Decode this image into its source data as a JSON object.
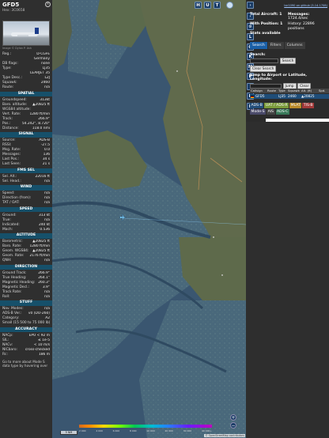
{
  "aircraft": {
    "callsign": "GFD5",
    "hex_line": "Hex: 3C0658",
    "photo_credit": "Image © Dylan P. Ash",
    "close_icon": "close-icon"
  },
  "info_top": [
    {
      "k": "Reg.:",
      "v": "D-CGFE"
    },
    {
      "k": "",
      "v": "Germany"
    },
    {
      "k": "DB flags:",
      "v": "none"
    },
    {
      "k": "Type:",
      "v": "LJ35"
    },
    {
      "k": "",
      "v": "LEARJET 35"
    },
    {
      "k": "Type Desc.:",
      "v": "L2J"
    },
    {
      "k": "Squawk:",
      "v": "2460"
    },
    {
      "k": "Route:",
      "v": "n/a"
    }
  ],
  "sections": [
    {
      "title": "SPATIAL",
      "rows": [
        {
          "k": "Groundspeed:",
          "v": "313kt"
        },
        {
          "k": "Baro. altitude:",
          "v": "▲20825 ft"
        },
        {
          "k": "WGS84 altitude:",
          "v": ""
        },
        {
          "k": "Vert. Rate:",
          "v": "1280 ft/min"
        },
        {
          "k": "Track:",
          "v": "266.9°"
        },
        {
          "k": "Pos.:",
          "v": "54.242°, 8.720°"
        },
        {
          "k": "Distance:",
          "v": "118.0 nmi"
        }
      ]
    },
    {
      "title": "SIGNAL",
      "rows": [
        {
          "k": "Source:",
          "v": "ADS-B"
        },
        {
          "k": "RSSI:",
          "v": "-27.5"
        },
        {
          "k": "Msg. Rate:",
          "v": "0.0"
        },
        {
          "k": "Messages:",
          "v": "136"
        },
        {
          "k": "Last Pos.:",
          "v": "34 s"
        },
        {
          "k": "Last Seen:",
          "v": "21 s"
        }
      ]
    },
    {
      "title": "FMS SEL",
      "rows": [
        {
          "k": "Sel. Alt.:",
          "v": "22016 ft"
        },
        {
          "k": "Sel. Head.:",
          "v": "n/a"
        }
      ]
    },
    {
      "title": "WIND",
      "rows": [
        {
          "k": "Speed:",
          "v": "n/a"
        },
        {
          "k": "Direction (from):",
          "v": "n/a"
        },
        {
          "k": "TAT / OAT:",
          "v": "n/a"
        }
      ]
    },
    {
      "title": "SPEED",
      "rows": [
        {
          "k": "Ground:",
          "v": "313 kt"
        },
        {
          "k": "True:",
          "v": "n/a"
        },
        {
          "k": "Indicated:",
          "v": "240 kt"
        },
        {
          "k": "Mach:",
          "v": "0.536"
        }
      ]
    },
    {
      "title": "ALTITUDE",
      "rows": [
        {
          "k": "Barometric:",
          "v": "▲20825 ft"
        },
        {
          "k": "Baro. Rate:",
          "v": "1280 ft/min"
        },
        {
          "k": "Geom. WGS84:",
          "v": "▲20825 ft"
        },
        {
          "k": "Geom. Rate:",
          "v": "2176 ft/min"
        },
        {
          "k": "QNH:",
          "v": "n/a"
        }
      ]
    },
    {
      "title": "DIRECTION",
      "rows": [
        {
          "k": "Ground Track:",
          "v": "266.9°"
        },
        {
          "k": "True Heading:",
          "v": "264.1°"
        },
        {
          "k": "Magnetic Heading:",
          "v": "260.3°"
        },
        {
          "k": "Magnetic Decl.:",
          "v": "3.9°"
        },
        {
          "k": "Track Rate:",
          "v": "n/a"
        },
        {
          "k": "Roll:",
          "v": "n/a"
        }
      ]
    },
    {
      "title": "STUFF",
      "rows": [
        {
          "k": "Nav. Modes:",
          "v": "n/a"
        },
        {
          "k": "ADS-B Ver.:",
          "v": "v0 (DO-260)"
        },
        {
          "k": "Category:",
          "v": "A2"
        },
        {
          "k": "Small (15 500 to 75 000 lb)",
          "v": ""
        }
      ]
    },
    {
      "title": "ACCURACY",
      "rows": [
        {
          "k": "NACp:",
          "v": "EPU < 92 m"
        },
        {
          "k": "SIL:",
          "v": "≤ 1e-5"
        },
        {
          "k": "NACv:",
          "v": "< 10 m/s"
        },
        {
          "k": "NICbaro:",
          "v": "cross-checked"
        },
        {
          "k": "Rc:",
          "v": "186 m"
        }
      ]
    }
  ],
  "footer_text": "Go to more about Mode S data type by hovering over",
  "map": {
    "top_buttons": [
      "H",
      "U",
      "T"
    ],
    "left_buttons": [
      "L",
      "O",
      "K",
      "M",
      "P",
      "I",
      "R",
      "F"
    ],
    "zoom_in": "+",
    "zoom_out": "−",
    "scale_label": "5 NM",
    "colorbar_labels": [
      "2 000",
      "4 000",
      "6 000",
      "8 000",
      "10 000",
      "20 000",
      "30 000",
      "40 000+"
    ],
    "attribution": "© OpenStreetMap contributors",
    "aircraft_icon": "airplane-icon"
  },
  "sidebar": {
    "github_link": "tar1090 on github (3.14.1708)",
    "total_aircraft_label": "Total Aircraft: 1",
    "messages_label": "Messages:",
    "messages_value": "1724.4/sec",
    "with_position_label": "With Position: 1",
    "history_label": "History: 22896 positions",
    "stats_label": "Stats available",
    "tabs": [
      "Search",
      "Filters",
      "Columns"
    ],
    "active_tab": "Search",
    "search_label": "Search:",
    "search_button": "Search",
    "clear_search_button": "Clear Search",
    "jump_label": "Jump to Airport or Latitude, Longitude:",
    "jump_button": "Jump",
    "clear_button": "Clear",
    "table_headers": [
      "Callsign",
      "Route",
      "Type",
      "Squawk",
      "Alt. (ft)",
      "Spd."
    ],
    "table_row": {
      "callsign": "GFD5",
      "type": "LJ35",
      "squawk": "2460",
      "alt": "▲20825"
    },
    "source_tags": [
      "ADS-B",
      "UAT / ADS-R",
      "MLAT",
      "TIS-B",
      "Mode-S",
      "AIS",
      "ADS-C"
    ]
  }
}
